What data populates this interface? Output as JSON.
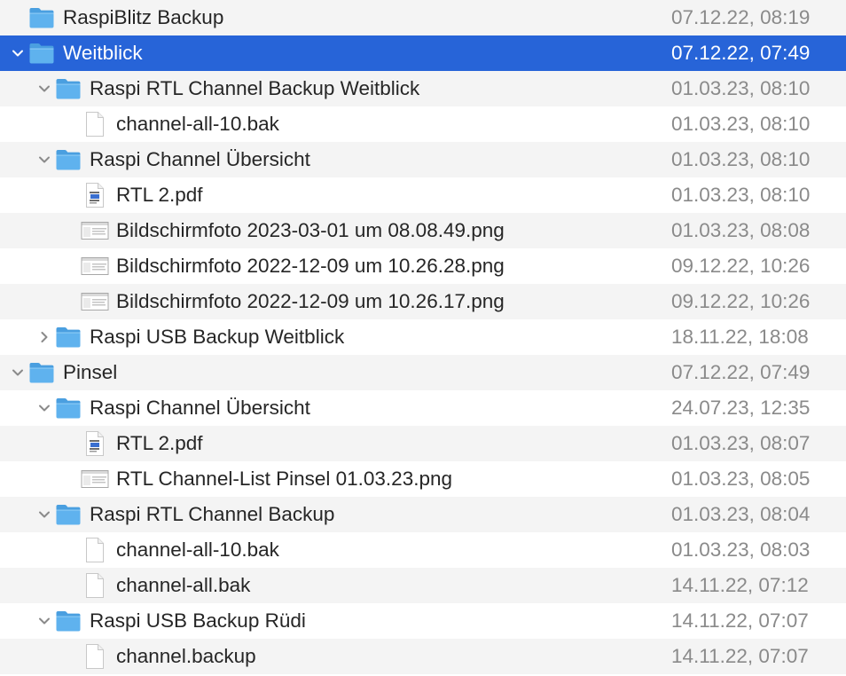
{
  "colors": {
    "selection": "#2764d8",
    "alt_row": "#f4f4f4",
    "folder": "#5fb2ee",
    "date_text": "#8a8a8a"
  },
  "rows": [
    {
      "name": "RaspiBlitz Backup",
      "date": "07.12.22, 08:19",
      "kind": "folder",
      "depth": 0,
      "disclosure": "none",
      "selected": false
    },
    {
      "name": "Weitblick",
      "date": "07.12.22, 07:49",
      "kind": "folder",
      "depth": 0,
      "disclosure": "expanded",
      "selected": true
    },
    {
      "name": "Raspi RTL Channel Backup Weitblick",
      "date": "01.03.23, 08:10",
      "kind": "folder",
      "depth": 1,
      "disclosure": "expanded",
      "selected": false
    },
    {
      "name": "channel-all-10.bak",
      "date": "01.03.23, 08:10",
      "kind": "file",
      "depth": 2,
      "disclosure": "none",
      "selected": false
    },
    {
      "name": "Raspi Channel Übersicht",
      "date": "01.03.23, 08:10",
      "kind": "folder",
      "depth": 1,
      "disclosure": "expanded",
      "selected": false
    },
    {
      "name": "RTL 2.pdf",
      "date": "01.03.23, 08:10",
      "kind": "pdf",
      "depth": 2,
      "disclosure": "none",
      "selected": false
    },
    {
      "name": "Bildschirmfoto 2023-03-01 um 08.08.49.png",
      "date": "01.03.23, 08:08",
      "kind": "image",
      "depth": 2,
      "disclosure": "none",
      "selected": false
    },
    {
      "name": "Bildschirmfoto 2022-12-09 um 10.26.28.png",
      "date": "09.12.22, 10:26",
      "kind": "image",
      "depth": 2,
      "disclosure": "none",
      "selected": false
    },
    {
      "name": "Bildschirmfoto 2022-12-09 um 10.26.17.png",
      "date": "09.12.22, 10:26",
      "kind": "image",
      "depth": 2,
      "disclosure": "none",
      "selected": false
    },
    {
      "name": "Raspi USB Backup Weitblick",
      "date": "18.11.22, 18:08",
      "kind": "folder",
      "depth": 1,
      "disclosure": "collapsed",
      "selected": false
    },
    {
      "name": "Pinsel",
      "date": "07.12.22, 07:49",
      "kind": "folder",
      "depth": 0,
      "disclosure": "expanded",
      "selected": false
    },
    {
      "name": "Raspi Channel Übersicht",
      "date": "24.07.23, 12:35",
      "kind": "folder",
      "depth": 1,
      "disclosure": "expanded",
      "selected": false
    },
    {
      "name": "RTL 2.pdf",
      "date": "01.03.23, 08:07",
      "kind": "pdf",
      "depth": 2,
      "disclosure": "none",
      "selected": false
    },
    {
      "name": "RTL Channel-List Pinsel 01.03.23.png",
      "date": "01.03.23, 08:05",
      "kind": "image",
      "depth": 2,
      "disclosure": "none",
      "selected": false
    },
    {
      "name": "Raspi RTL Channel Backup",
      "date": "01.03.23, 08:04",
      "kind": "folder",
      "depth": 1,
      "disclosure": "expanded",
      "selected": false
    },
    {
      "name": "channel-all-10.bak",
      "date": "01.03.23, 08:03",
      "kind": "file",
      "depth": 2,
      "disclosure": "none",
      "selected": false
    },
    {
      "name": "channel-all.bak",
      "date": "14.11.22, 07:12",
      "kind": "file",
      "depth": 2,
      "disclosure": "none",
      "selected": false
    },
    {
      "name": "Raspi USB Backup Rüdi",
      "date": "14.11.22, 07:07",
      "kind": "folder",
      "depth": 1,
      "disclosure": "expanded",
      "selected": false
    },
    {
      "name": "channel.backup",
      "date": "14.11.22, 07:07",
      "kind": "file",
      "depth": 2,
      "disclosure": "none",
      "selected": false
    }
  ]
}
